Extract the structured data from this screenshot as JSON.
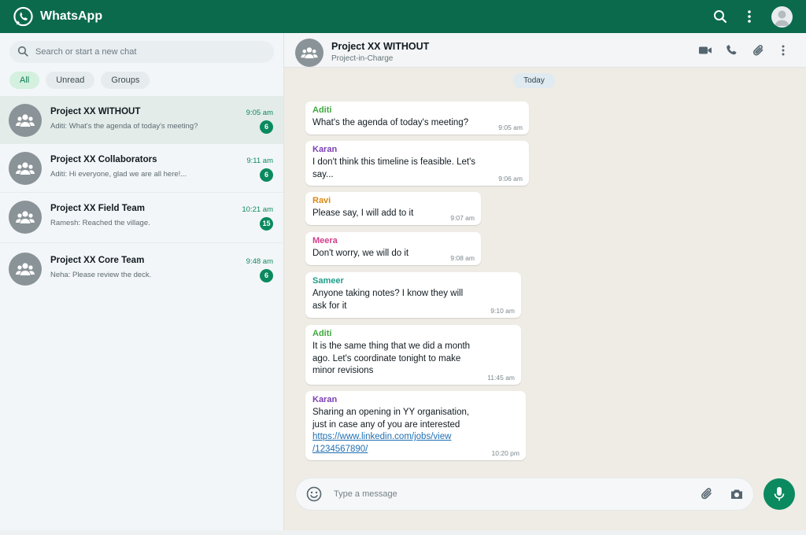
{
  "app": {
    "title": "WhatsApp",
    "brand_color": "#0b6a4c",
    "accent_color": "#0b8a5f",
    "icons": [
      "whatsapp-logo-icon",
      "search-icon",
      "more-vertical-icon",
      "profile-avatar-icon"
    ]
  },
  "sidebar": {
    "search_placeholder": "Search or start a new chat",
    "filters": [
      {
        "label": "All",
        "active": true
      },
      {
        "label": "Unread",
        "active": false
      },
      {
        "label": "Groups",
        "active": false
      }
    ],
    "chats": [
      {
        "name": "Project XX WITHOUT",
        "time": "9:05 am",
        "preview": "Aditi: What's the agenda of today's meeting?",
        "unread": "6",
        "active": true
      },
      {
        "name": "Project XX Collaborators",
        "time": "9:11 am",
        "preview": "Aditi: Hi everyone, glad we are all here!...",
        "unread": "6",
        "active": false
      },
      {
        "name": "Project XX Field Team",
        "time": "10:21 am",
        "preview": "Ramesh: Reached the village.",
        "unread": "15",
        "active": false
      },
      {
        "name": "Project XX Core Team",
        "time": "9:48 am",
        "preview": "Neha: Please review the deck.",
        "unread": "6",
        "active": false
      }
    ]
  },
  "conversation": {
    "name": "Project XX WITHOUT",
    "subtitle": "Project-in-Charge",
    "header_icons": [
      "video-call-icon",
      "voice-call-icon",
      "attach-icon",
      "more-vertical-icon"
    ],
    "date_label": "Today",
    "messages": [
      {
        "sender": "Aditi",
        "sender_color": "#3fa83f",
        "lines": [
          "What's the agenda of today's meeting?"
        ],
        "time": "9:05 am"
      },
      {
        "sender": "Karan",
        "sender_color": "#7b3fb3",
        "lines": [
          "I don't think this timeline is feasible. Let's",
          "say..."
        ],
        "time": "9:06 am"
      },
      {
        "sender": "Ravi",
        "sender_color": "#d98a0f",
        "lines": [
          "Please say, I will add to it"
        ],
        "time": "9:07 am"
      },
      {
        "sender": "Meera",
        "sender_color": "#d23f8c",
        "lines": [
          "Don't worry, we will do it"
        ],
        "time": "9:08 am"
      },
      {
        "sender": "Sameer",
        "sender_color": "#1f9e8a",
        "lines": [
          "Anyone taking notes? I know they will",
          "ask for it"
        ],
        "time": "9:10 am"
      },
      {
        "sender": "Aditi",
        "sender_color": "#3fa83f",
        "lines": [
          "It is the same thing that we did a month",
          "ago. Let's coordinate tonight to make",
          "minor revisions"
        ],
        "time": "11:45 am"
      },
      {
        "sender": "Karan",
        "sender_color": "#7b3fb3",
        "lines": [
          "Sharing an opening in YY organisation,",
          "just in case any of you are interested"
        ],
        "link_lines": [
          "https://www.linkedin.com/jobs/view",
          "/1234567890/"
        ],
        "time": "10:20 pm"
      }
    ],
    "composer_placeholder": "Type a message",
    "composer_icons": [
      "emoji-icon",
      "attach-icon",
      "camera-icon",
      "microphone-icon"
    ]
  }
}
